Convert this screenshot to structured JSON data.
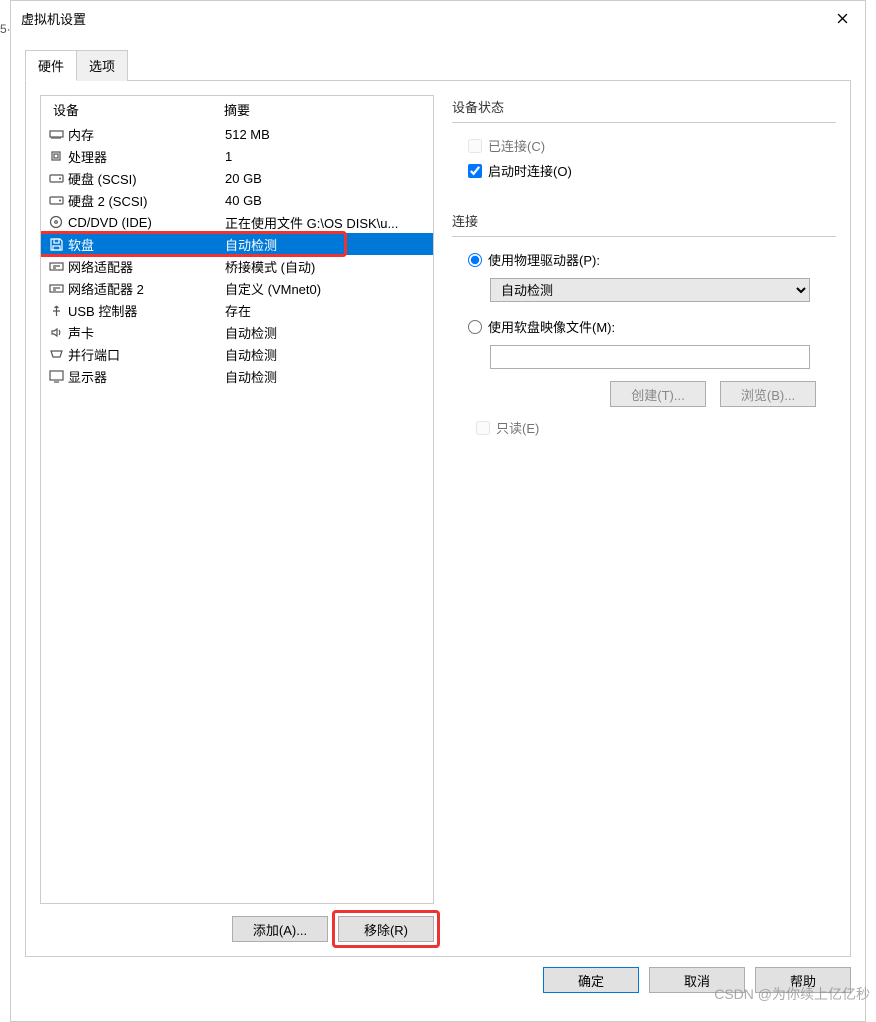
{
  "title": "虚拟机设置",
  "tabs": {
    "hardware": "硬件",
    "options": "选项"
  },
  "columns": {
    "device": "设备",
    "summary": "摘要"
  },
  "devices": [
    {
      "icon": "memory",
      "name": "内存",
      "summary": "512 MB"
    },
    {
      "icon": "cpu",
      "name": "处理器",
      "summary": "1"
    },
    {
      "icon": "hdd",
      "name": "硬盘 (SCSI)",
      "summary": "20 GB"
    },
    {
      "icon": "hdd",
      "name": "硬盘 2 (SCSI)",
      "summary": "40 GB"
    },
    {
      "icon": "cd",
      "name": "CD/DVD (IDE)",
      "summary": "正在使用文件 G:\\OS DISK\\u..."
    },
    {
      "icon": "floppy",
      "name": "软盘",
      "summary": "自动检测",
      "selected": true
    },
    {
      "icon": "nic",
      "name": "网络适配器",
      "summary": "桥接模式 (自动)"
    },
    {
      "icon": "nic",
      "name": "网络适配器 2",
      "summary": "自定义 (VMnet0)"
    },
    {
      "icon": "usb",
      "name": "USB 控制器",
      "summary": "存在"
    },
    {
      "icon": "sound",
      "name": "声卡",
      "summary": "自动检测"
    },
    {
      "icon": "parallel",
      "name": "并行端口",
      "summary": "自动检测"
    },
    {
      "icon": "display",
      "name": "显示器",
      "summary": "自动检测"
    }
  ],
  "left_buttons": {
    "add": "添加(A)...",
    "remove": "移除(R)"
  },
  "status": {
    "title": "设备状态",
    "connected": "已连接(C)",
    "connect_on_power": "启动时连接(O)"
  },
  "connection": {
    "title": "连接",
    "use_physical": "使用物理驱动器(P):",
    "physical_value": "自动检测",
    "use_image": "使用软盘映像文件(M):",
    "create": "创建(T)...",
    "browse": "浏览(B)...",
    "readonly": "只读(E)"
  },
  "footer": {
    "ok": "确定",
    "cancel": "取消",
    "help": "帮助"
  },
  "watermark": "CSDN @为你续上亿亿秒"
}
